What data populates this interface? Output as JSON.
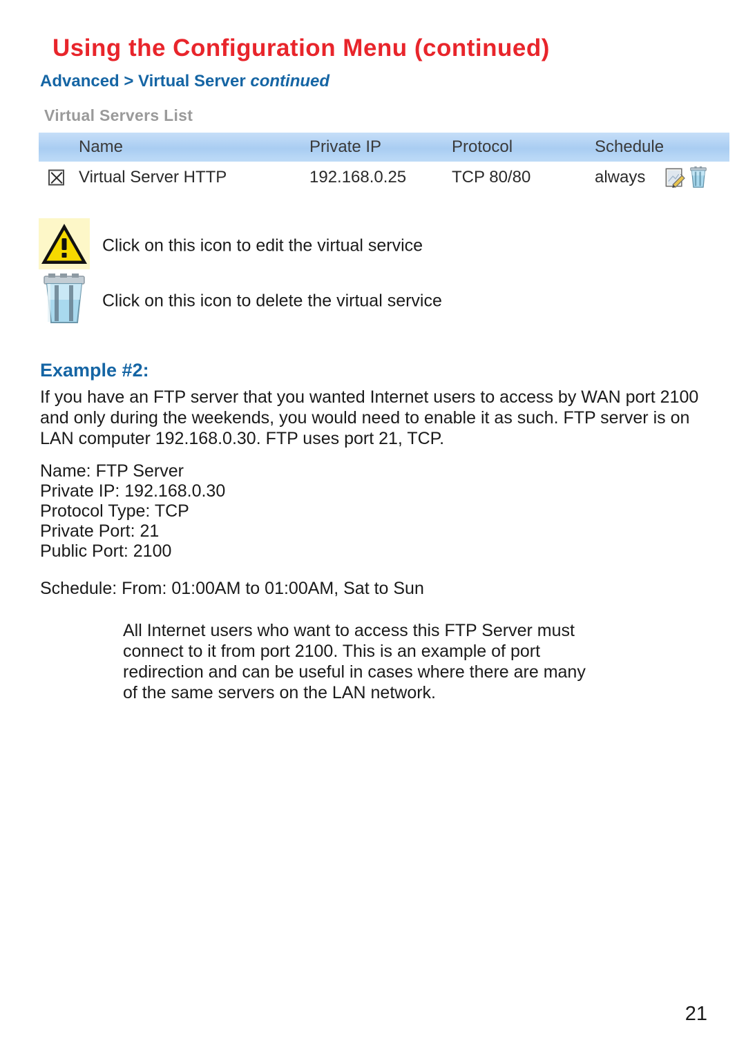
{
  "header": {
    "title": "Using the Configuration Menu (continued)",
    "breadcrumb_main": "Advanced > Virtual Server ",
    "breadcrumb_continued": "continued",
    "title_color": "#e8252b",
    "breadcrumb_color": "#1565a4"
  },
  "screenshot": {
    "panel_title": "Virtual Servers List",
    "header_bg_color": "#a9cdf2",
    "columns": [
      "Name",
      "Private IP",
      "Protocol",
      "Schedule"
    ],
    "rows": [
      {
        "enabled": true,
        "name": "Virtual Server HTTP",
        "private_ip": "192.168.0.25",
        "protocol": "TCP 80/80",
        "schedule": "always",
        "actions": [
          "edit-icon",
          "delete-icon"
        ]
      }
    ]
  },
  "legend": [
    {
      "icon": "warning-triangle-icon",
      "text": "Click on this icon to edit the virtual service"
    },
    {
      "icon": "trash-can-icon",
      "text": "Click on this icon to delete the virtual service"
    }
  ],
  "example": {
    "heading": "Example #2:",
    "intro": "If you have an FTP server that you wanted Internet users to access by WAN port 2100 and only during the weekends, you would need to enable it as such. FTP server is on LAN computer 192.168.0.30. FTP uses port 21, TCP.",
    "spec": {
      "name": "Name: FTP Server",
      "private_ip": "Private IP: 192.168.0.30",
      "protocol_type": "Protocol Type: TCP",
      "private_port": "Private Port: 21",
      "public_port": "Public Port: 2100"
    },
    "schedule": "Schedule: From: 01:00AM to 01:00AM, Sat to Sun",
    "closing": "All Internet users who want to access this FTP Server must connect to it from port 2100. This is an example of port redirection and can be useful in cases where there are many of the same servers on the LAN network."
  },
  "footer": {
    "page_number": "21"
  }
}
